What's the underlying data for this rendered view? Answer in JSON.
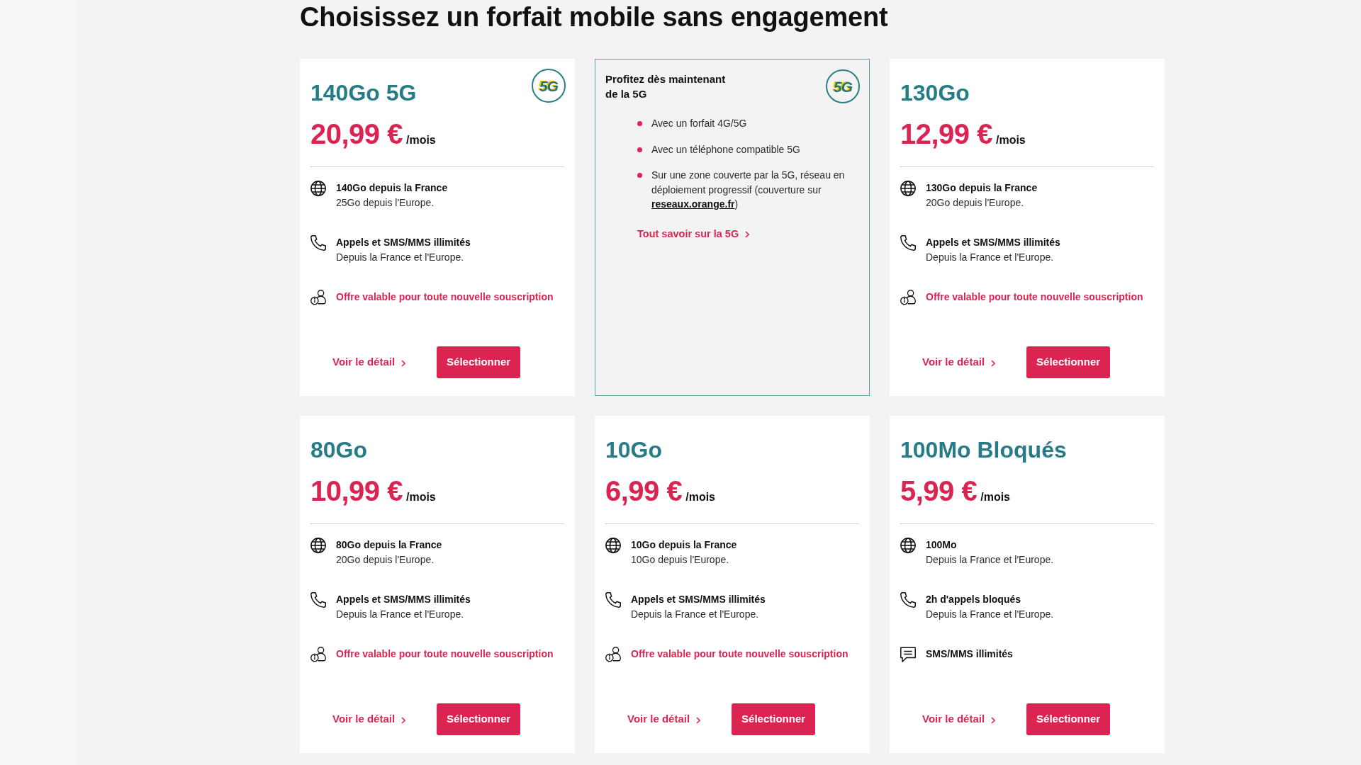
{
  "page_title": "Choisissez un forfait mobile sans engagement",
  "cards": [
    {
      "kind": "plan",
      "name": "140Go 5G",
      "badge": "5G",
      "price": "20,99 €",
      "price_unit": "/mois",
      "features": [
        {
          "kind": "data",
          "title": "140Go depuis la France",
          "subtitle": "25Go depuis l'Europe."
        },
        {
          "kind": "calls",
          "title": "Appels et SMS/MMS illimités",
          "subtitle": "Depuis la France et l'Europe."
        },
        {
          "kind": "offer",
          "title": "Offre valable pour toute nouvelle souscription"
        }
      ],
      "details_link": "Voir le détail",
      "select_button": "Sélectionner"
    },
    {
      "kind": "promo",
      "heading": "Profitez dès maintenant de la 5G",
      "badge": "5G",
      "bullets": [
        {
          "text": "Avec un forfait 4G/5G"
        },
        {
          "text": "Avec un téléphone compatible 5G"
        },
        {
          "text": "Sur une zone couverte par la 5G, réseau en déploiement progressif (couverture sur ",
          "link": "reseaux.orange.fr",
          "text_after": ")"
        }
      ],
      "link": "Tout savoir sur la 5G"
    },
    {
      "kind": "plan",
      "name": "130Go",
      "price": "12,99 €",
      "price_unit": "/mois",
      "features": [
        {
          "kind": "data",
          "title": "130Go depuis la France",
          "subtitle": "20Go depuis l'Europe."
        },
        {
          "kind": "calls",
          "title": "Appels et SMS/MMS illimités",
          "subtitle": "Depuis la France et l'Europe."
        },
        {
          "kind": "offer",
          "title": "Offre valable pour toute nouvelle souscription"
        }
      ],
      "details_link": "Voir le détail",
      "select_button": "Sélectionner"
    },
    {
      "kind": "plan",
      "name": "80Go",
      "price": "10,99 €",
      "price_unit": "/mois",
      "features": [
        {
          "kind": "data",
          "title": "80Go depuis la France",
          "subtitle": "20Go depuis l'Europe."
        },
        {
          "kind": "calls",
          "title": "Appels et SMS/MMS illimités",
          "subtitle": "Depuis la France et l'Europe."
        },
        {
          "kind": "offer",
          "title": "Offre valable pour toute nouvelle souscription"
        }
      ],
      "details_link": "Voir le détail",
      "select_button": "Sélectionner"
    },
    {
      "kind": "plan",
      "name": "10Go",
      "price": "6,99 €",
      "price_unit": "/mois",
      "features": [
        {
          "kind": "data",
          "title": "10Go depuis la France",
          "subtitle": "10Go depuis l'Europe."
        },
        {
          "kind": "calls",
          "title": "Appels et SMS/MMS illimités",
          "subtitle": "Depuis la France et l'Europe."
        },
        {
          "kind": "offer",
          "title": "Offre valable pour toute nouvelle souscription"
        }
      ],
      "details_link": "Voir le détail",
      "select_button": "Sélectionner"
    },
    {
      "kind": "plan",
      "name": "100Mo Bloqués",
      "price": "5,99 €",
      "price_unit": "/mois",
      "features": [
        {
          "kind": "data",
          "title": "100Mo",
          "subtitle": "Depuis la France et l'Europe."
        },
        {
          "kind": "calls",
          "title": "2h d'appels bloqués",
          "subtitle": "Depuis la France et l'Europe."
        },
        {
          "kind": "sms",
          "title": "SMS/MMS illimités"
        }
      ],
      "details_link": "Voir le détail",
      "select_button": "Sélectionner"
    }
  ]
}
